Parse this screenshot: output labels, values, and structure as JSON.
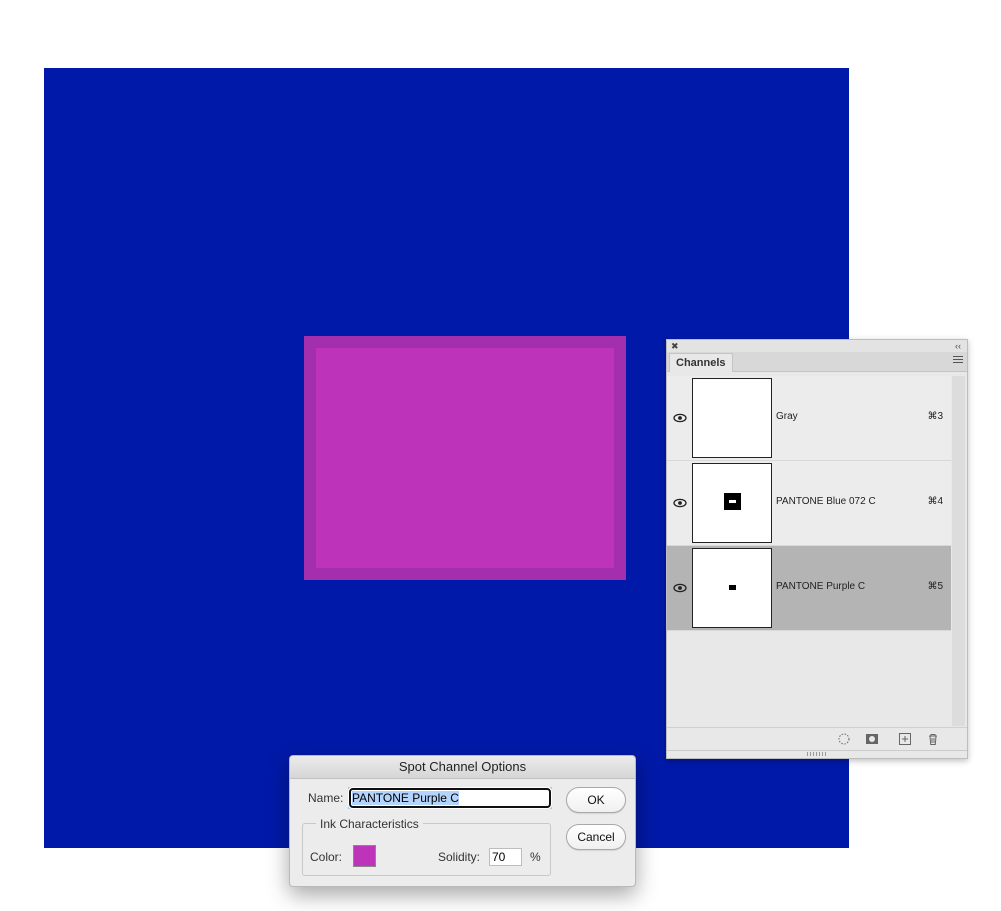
{
  "document": {
    "canvas_color": "#0019a8",
    "spot_outer_color": "#a32eae",
    "spot_inner_color": "#bd34bb"
  },
  "channels_panel": {
    "tab_label": "Channels",
    "close_icon": "close-icon",
    "collapse_icon": "double-chevron-left-icon",
    "menu_icon": "hamburger-menu-icon",
    "channels": [
      {
        "name": "Gray",
        "shortcut": "⌘3",
        "visible": true,
        "selected": false
      },
      {
        "name": "PANTONE Blue 072 C",
        "shortcut": "⌘4",
        "visible": true,
        "selected": false
      },
      {
        "name": "PANTONE Purple C",
        "shortcut": "⌘5",
        "visible": true,
        "selected": true
      }
    ],
    "footer_icons": [
      "load-selection-icon",
      "save-selection-icon",
      "new-channel-icon",
      "delete-channel-icon"
    ]
  },
  "dialog": {
    "title": "Spot Channel Options",
    "name_label": "Name:",
    "name_value": "PANTONE Purple C",
    "ink_group_label": "Ink Characteristics",
    "color_label": "Color:",
    "color_value": "#bd34bb",
    "solidity_label": "Solidity:",
    "solidity_value": "70",
    "solidity_unit": "%",
    "ok_label": "OK",
    "cancel_label": "Cancel"
  }
}
